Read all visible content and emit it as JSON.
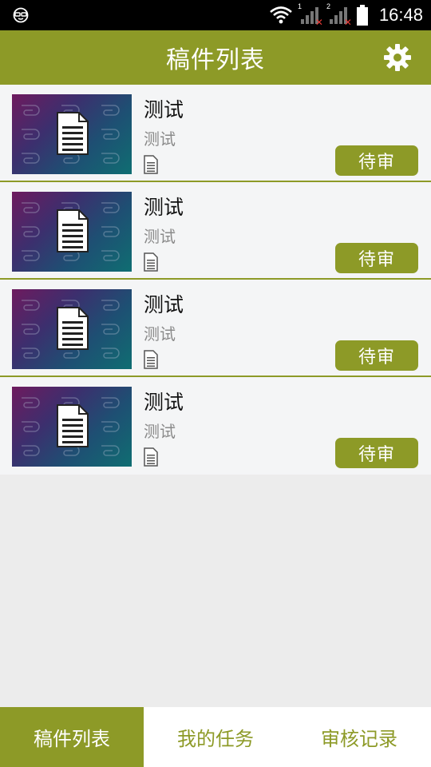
{
  "status_bar": {
    "time": "16:48",
    "sim1_label": "1",
    "sim2_label": "2",
    "icons": [
      "face-icon",
      "wifi-icon",
      "signal-sim1-icon",
      "signal-sim2-icon",
      "battery-icon"
    ]
  },
  "app_bar": {
    "title": "稿件列表",
    "settings_icon": "gear-icon"
  },
  "items": [
    {
      "title": "测试",
      "subtitle": "测试",
      "status": "待审"
    },
    {
      "title": "测试",
      "subtitle": "测试",
      "status": "待审"
    },
    {
      "title": "测试",
      "subtitle": "测试",
      "status": "待审"
    },
    {
      "title": "测试",
      "subtitle": "测试",
      "status": "待审"
    }
  ],
  "tabs": [
    {
      "label": "稿件列表",
      "active": true
    },
    {
      "label": "我的任务",
      "active": false
    },
    {
      "label": "审核记录",
      "active": false
    }
  ],
  "colors": {
    "accent": "#8d9a27",
    "list_bg": "#f4f5f6",
    "page_bg": "#ececec"
  }
}
